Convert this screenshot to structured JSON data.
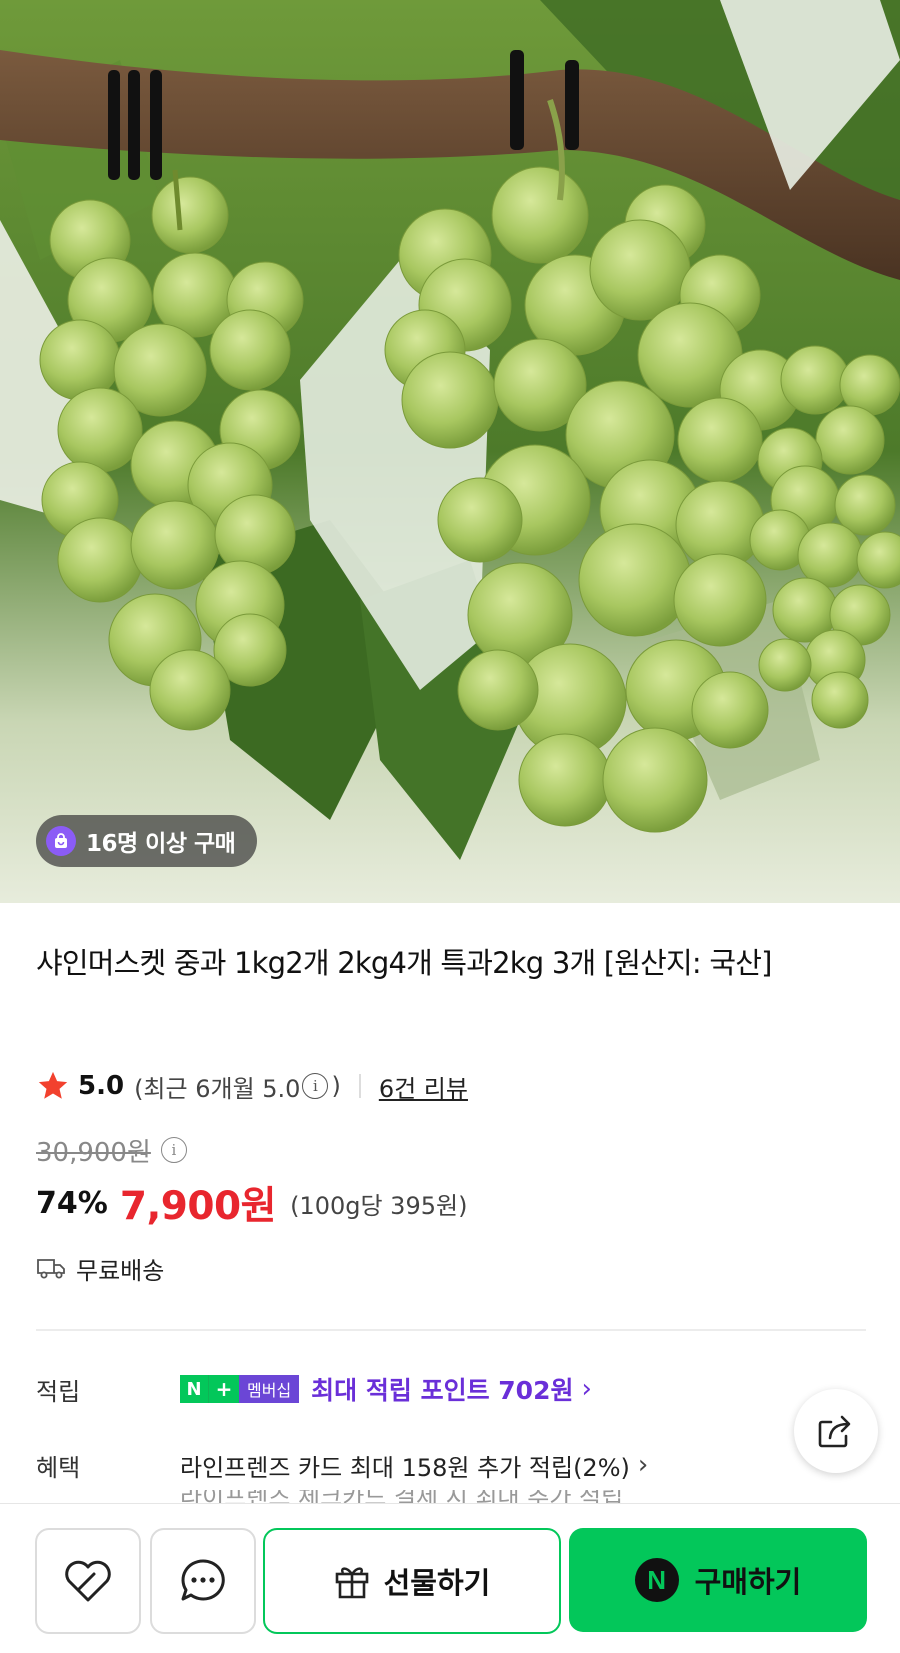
{
  "hero": {
    "buyer_badge": "16명 이상 구매"
  },
  "product": {
    "title": "샤인머스켓 중과 1kg2개 2kg4개 특과2kg 3개 [원산지: 국산]",
    "rating": "5.0",
    "rating_recent_prefix": "(최근 6개월 5.0",
    "rating_recent_suffix": ")",
    "review_link": "6건 리뷰",
    "original_price": "30,900원",
    "discount": "74%",
    "price": "7,900원",
    "unit_price": "(100g당 395원)",
    "shipping": "무료배송"
  },
  "benefits": {
    "points_label": "적립",
    "badge_n": "N",
    "badge_plus": "+",
    "badge_membership": "멤버십",
    "points_text": "최대 적립 포인트 702원",
    "benefit_label": "혜택",
    "card_text": "라인프렌즈 카드 최대 158원 추가 적립(2%)",
    "clipped_text": "라이프렌즈 체크카드 결제 시 최대 추가 적립"
  },
  "bottom_bar": {
    "gift_label": "선물하기",
    "buy_label": "구매하기",
    "buy_logo": "N"
  },
  "colors": {
    "accent_green": "#03c75a",
    "price_red": "#e8262e",
    "points_purple": "#6a2fd8"
  },
  "icons": [
    "shopping-bag-icon",
    "star-icon",
    "info-icon",
    "truck-icon",
    "chevron-right-icon",
    "share-icon",
    "heart-icon",
    "chat-icon",
    "gift-icon",
    "naver-n-icon"
  ]
}
